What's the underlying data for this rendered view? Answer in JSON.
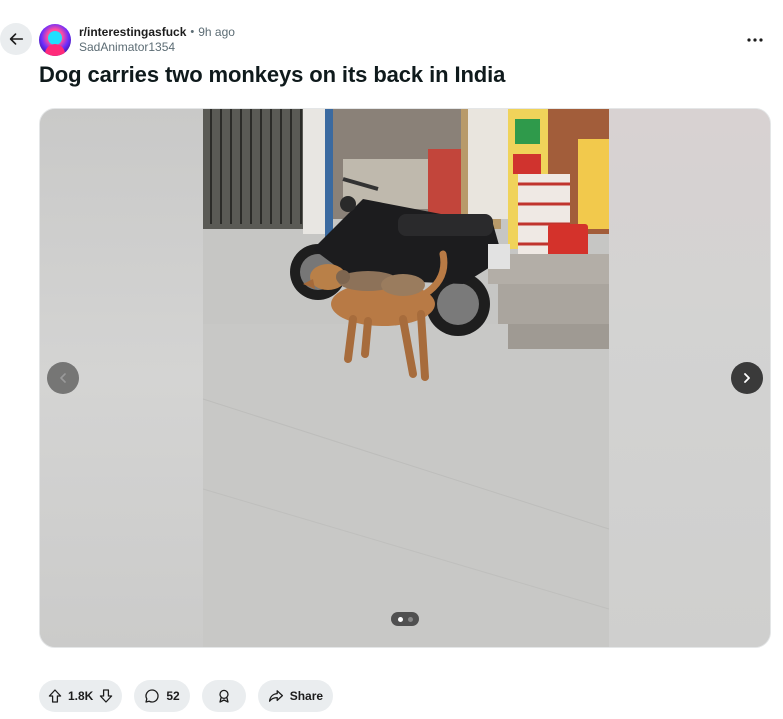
{
  "post": {
    "subreddit": "r/interestingasfuck",
    "separator": "•",
    "time_ago": "9h ago",
    "author": "SadAnimator1354",
    "title": "Dog carries two monkeys on its back in India"
  },
  "media": {
    "gallery_position": 1,
    "gallery_count": 2
  },
  "actions": {
    "votes": "1.8K",
    "comments": "52",
    "share_label": "Share"
  },
  "icons": {
    "back": "arrow-left-icon",
    "more": "more-horizontal-icon",
    "prev": "chevron-left-icon",
    "next": "chevron-right-icon",
    "upvote": "upvote-arrow-icon",
    "downvote": "downvote-arrow-icon",
    "comment": "comment-bubble-icon",
    "award": "award-icon",
    "share": "share-arrow-icon"
  },
  "colors": {
    "pill_bg": "#eaedef",
    "text_primary": "#1c1c1c",
    "text_secondary": "#5c6c74"
  }
}
